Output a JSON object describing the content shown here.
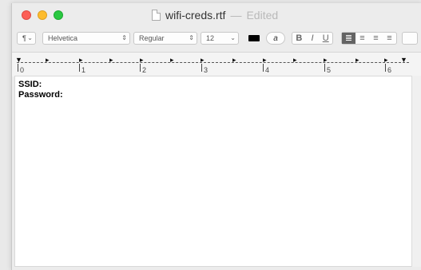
{
  "window": {
    "filename": "wifi-creds.rtf",
    "separator": "—",
    "status": "Edited"
  },
  "toolbar": {
    "paragraph_style": "¶",
    "font_family": "Helvetica",
    "font_style": "Regular",
    "font_size": "12",
    "text_color": "#000000",
    "highlight_glyph": "a",
    "bold": "B",
    "italic": "I",
    "underline": "U",
    "align_icons": [
      "≣",
      "≡",
      "≡",
      "≡"
    ]
  },
  "ruler": {
    "numbers": [
      "0",
      "1",
      "2",
      "3",
      "4",
      "5",
      "6"
    ]
  },
  "document": {
    "lines": [
      "SSID:",
      "Password:"
    ]
  }
}
